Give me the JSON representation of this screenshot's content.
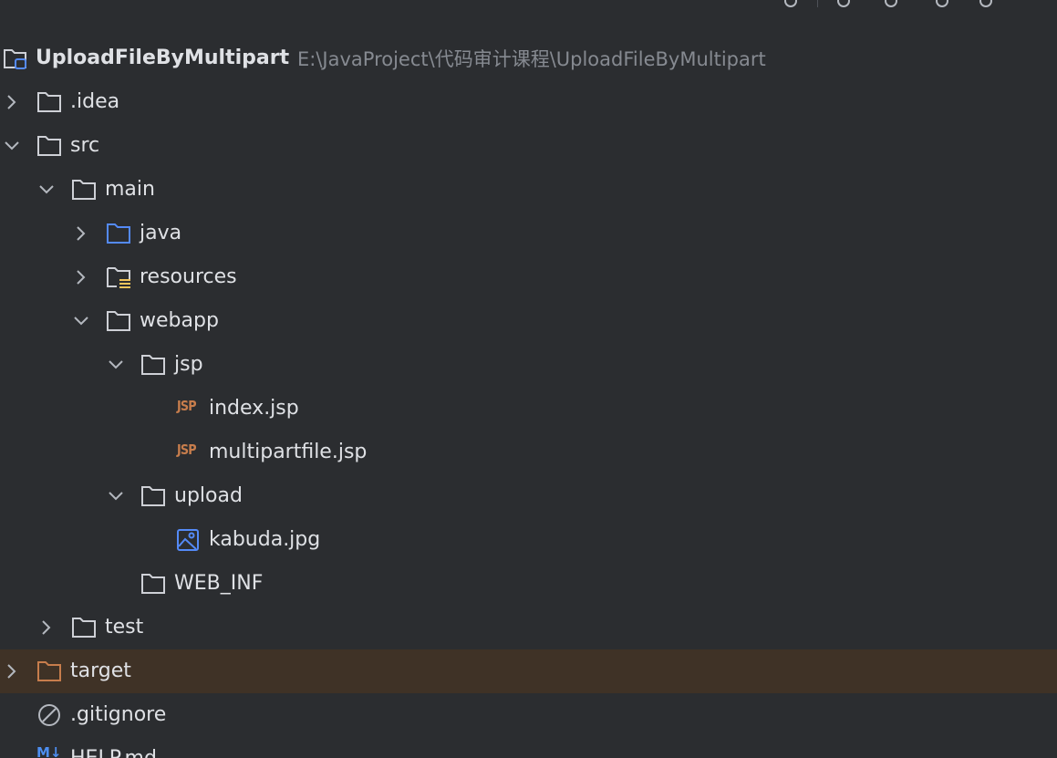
{
  "project": {
    "name": "UploadFileByMultipart",
    "path": "E:\\JavaProject\\代码审计课程\\UploadFileByMultipart"
  },
  "tree": {
    "idea": ".idea",
    "src": "src",
    "main": "main",
    "java": "java",
    "resources": "resources",
    "webapp": "webapp",
    "jsp": "jsp",
    "jsp_badge": "JSP",
    "index_jsp": "index.jsp",
    "multipartfile_jsp": "multipartfile.jsp",
    "upload": "upload",
    "kabuda_jpg": "kabuda.jpg",
    "web_inf": "WEB_INF",
    "test": "test",
    "target": "target",
    "gitignore": ".gitignore",
    "md_badge": "M↓",
    "help_md": "HELP.md"
  },
  "colors": {
    "background": "#2b2d30",
    "selected_row": "#3f3226",
    "folder_outline": "#ced0d6",
    "source_folder": "#548af7",
    "excluded_folder": "#c77d4c",
    "resource_marker": "#f2c55c"
  }
}
